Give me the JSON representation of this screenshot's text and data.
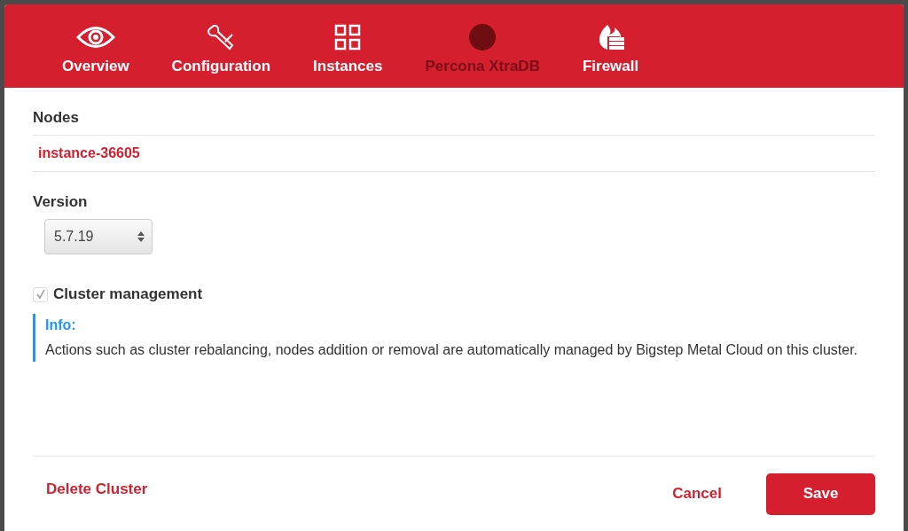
{
  "tabs": [
    {
      "label": "Overview",
      "kind": "eye",
      "selected": false
    },
    {
      "label": "Configuration",
      "kind": "wrench",
      "selected": false
    },
    {
      "label": "Instances",
      "kind": "grid",
      "selected": false
    },
    {
      "label": "Percona XtraDB",
      "kind": "circle",
      "selected": true
    },
    {
      "label": "Firewall",
      "kind": "firewall",
      "selected": false
    }
  ],
  "nodes": {
    "label": "Nodes",
    "items": [
      "instance-36605"
    ]
  },
  "version": {
    "label": "Version",
    "value": "5.7.19"
  },
  "cluster_management": {
    "label": "Cluster management",
    "checked": true,
    "disabled": true
  },
  "info": {
    "title": "Info:",
    "text": "Actions such as cluster rebalancing, nodes addition or removal are automatically managed by Bigstep Metal Cloud on this cluster."
  },
  "footer": {
    "delete": "Delete Cluster",
    "cancel": "Cancel",
    "save": "Save"
  }
}
